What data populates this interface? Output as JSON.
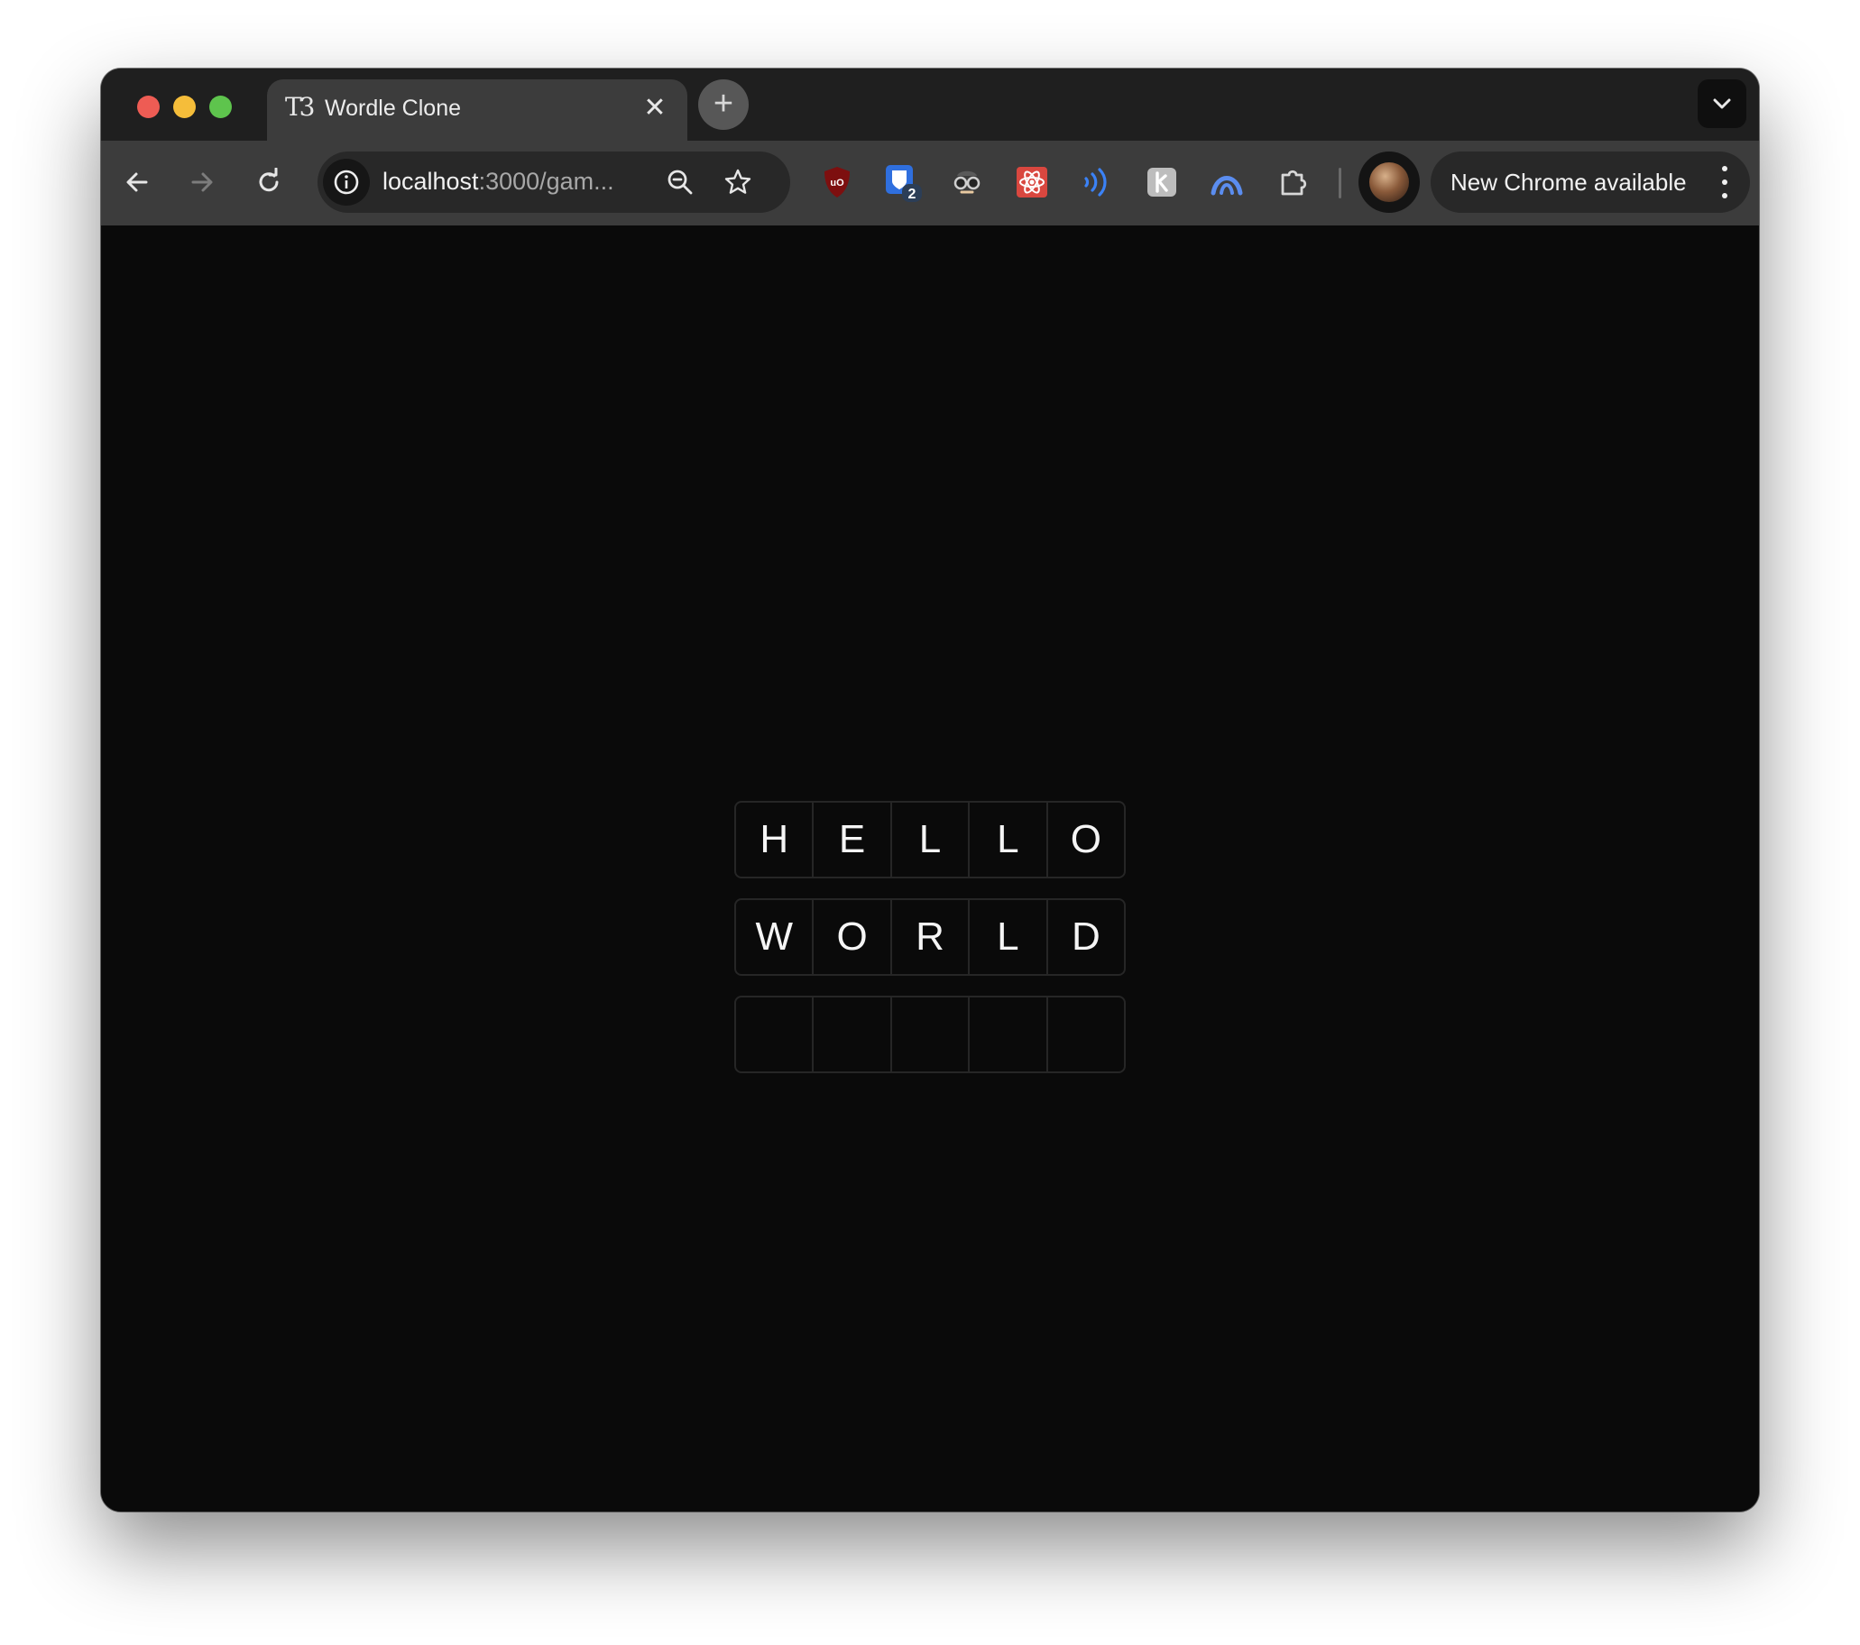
{
  "browser": {
    "tab": {
      "favicon_text": "T3",
      "title": "Wordle Clone",
      "close_glyph": "✕"
    },
    "new_tab_glyph": "+",
    "omnibox": {
      "url_host": "localhost",
      "url_path": ":3000/gam..."
    },
    "extensions": [
      {
        "name": "ublock-origin-icon",
        "color": "#b31b1b"
      },
      {
        "name": "bitwarden-icon",
        "color": "#2f6fde",
        "badge": "2"
      },
      {
        "name": "spy-glasses-icon",
        "color": "#cfcfcf"
      },
      {
        "name": "react-devtools-icon",
        "color": "#e0524a"
      },
      {
        "name": "broadcast-waves-icon",
        "color": "#3b82f6"
      },
      {
        "name": "k-extension-icon",
        "color": "#bdbdbd"
      },
      {
        "name": "arc-extension-icon",
        "color": "#5b8def"
      },
      {
        "name": "puzzle-piece-icon",
        "color": "#d8d8d8"
      }
    ],
    "update_label": "New Chrome available"
  },
  "game": {
    "rows": [
      [
        "H",
        "E",
        "L",
        "L",
        "O"
      ],
      [
        "W",
        "O",
        "R",
        "L",
        "D"
      ],
      [
        "",
        "",
        "",
        "",
        ""
      ]
    ]
  },
  "colors": {
    "page_background": "#0a0a0a",
    "tile_border": "#262626",
    "tile_text": "#f5f5f5"
  }
}
